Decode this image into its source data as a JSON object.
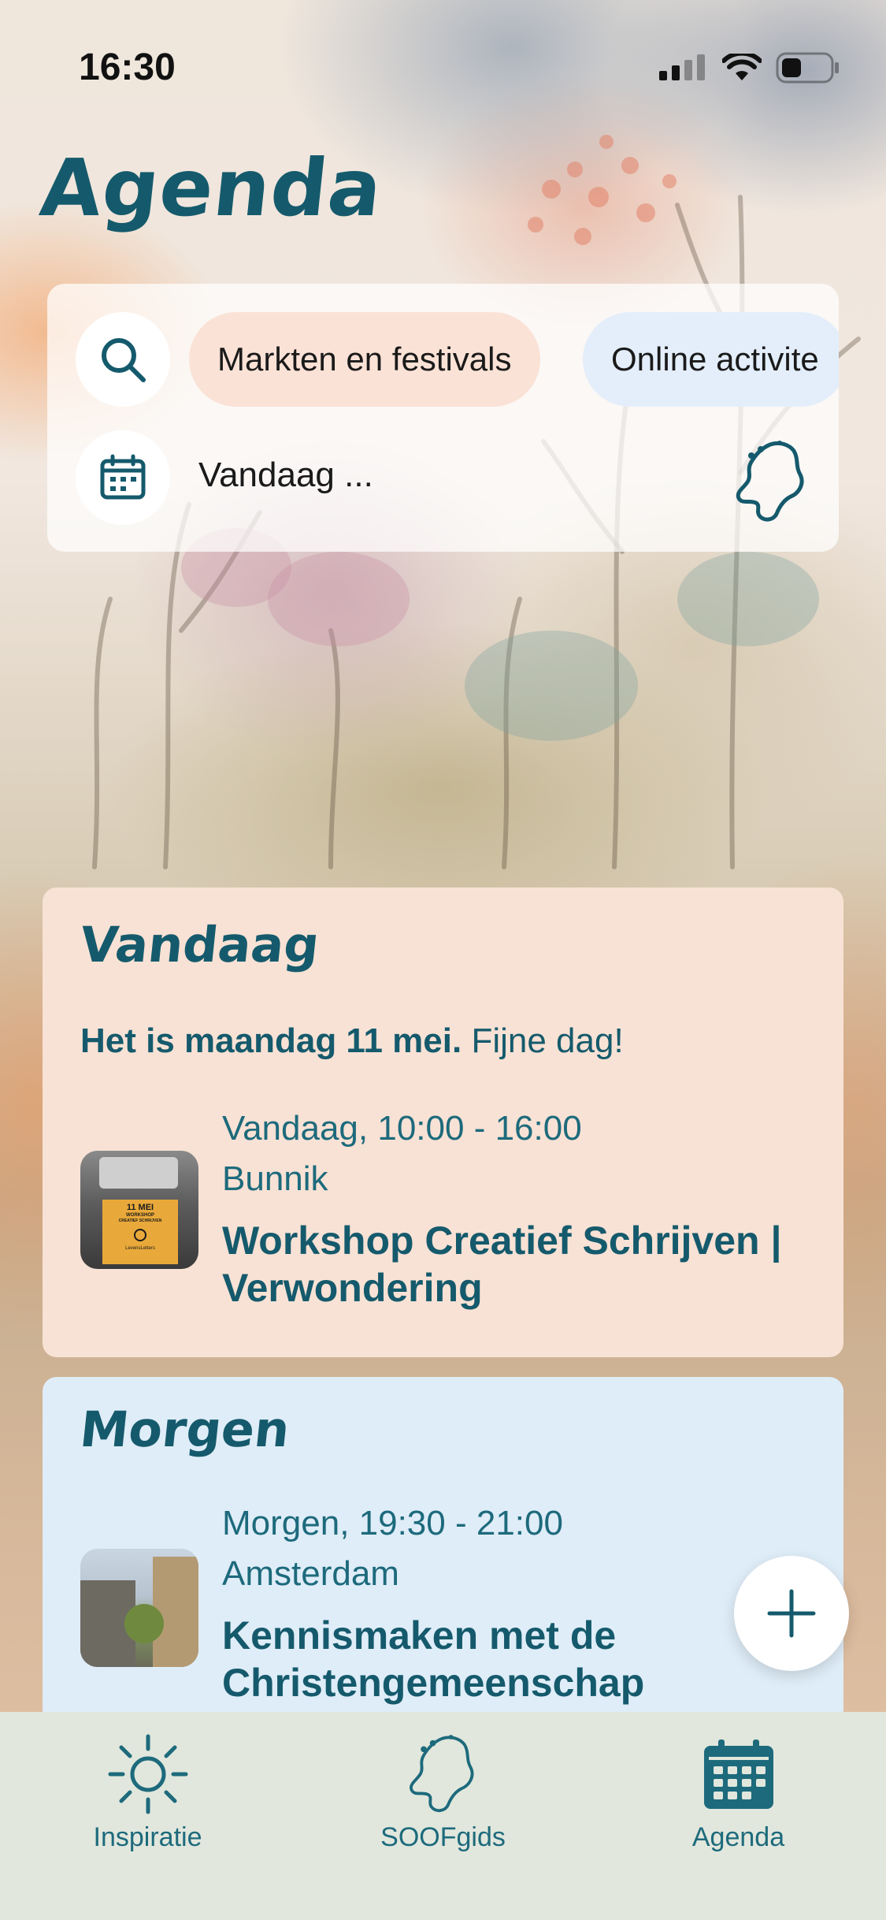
{
  "status_bar": {
    "time": "16:30"
  },
  "page": {
    "title": "Agenda"
  },
  "filters": {
    "chips": [
      {
        "label": "Markten en festivals",
        "color": "#fbe2d6"
      },
      {
        "label": "Online activite",
        "color": "#e3eefa"
      }
    ],
    "date_label": "Vandaag ..."
  },
  "today": {
    "heading": "Vandaag",
    "greeting_bold": "Het is maandag 11 mei.",
    "greeting_rest": " Fijne dag!",
    "event": {
      "when": "Vandaag, 10:00 - 16:00",
      "where": "Bunnik",
      "title": "Workshop Creatief Schrijven | Verwondering",
      "thumb_line1": "11 MEI",
      "thumb_line2": "WORKSHOP",
      "thumb_line3": "CREATIEF SCHRIJVEN",
      "thumb_brand": "LevensLetters"
    }
  },
  "tomorrow": {
    "heading": "Morgen",
    "event": {
      "when": "Morgen, 19:30 - 21:00",
      "where": "Amsterdam",
      "title": "Kennismaken met de Christengemeenschap"
    }
  },
  "tab_bar": {
    "items": [
      {
        "label": "Inspiratie",
        "icon": "sun-icon"
      },
      {
        "label": "SOOFgids",
        "icon": "netherlands-map-icon"
      },
      {
        "label": "Agenda",
        "icon": "calendar-icon"
      }
    ]
  },
  "colors": {
    "accent": "#155a6c",
    "today_card": "#f8e2d5",
    "tomorrow_card": "#dfedf8",
    "tab_bar": "#e1e7dd"
  }
}
